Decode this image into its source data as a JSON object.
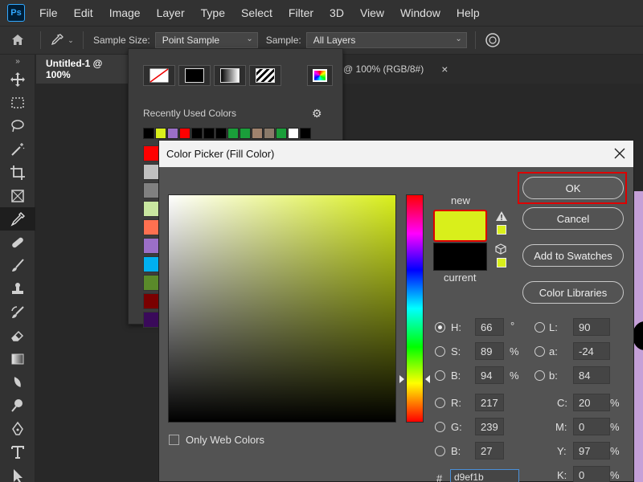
{
  "app": {
    "logo": "Ps"
  },
  "menubar": {
    "items": [
      "File",
      "Edit",
      "Image",
      "Layer",
      "Type",
      "Select",
      "Filter",
      "3D",
      "View",
      "Window",
      "Help"
    ]
  },
  "options_bar": {
    "sample_size_label": "Sample Size:",
    "sample_size_value": "Point Sample",
    "sample_label": "Sample:",
    "sample_value": "All Layers"
  },
  "document_tabs": {
    "tab1": "Untitled-1 @ 100%",
    "tab2": "@ 100% (RGB/8#)",
    "tab2_close": "×"
  },
  "swatch_popup": {
    "recent_label": "Recently Used Colors",
    "recent_colors": [
      "#000000",
      "#d9ef1b",
      "#9b6fc7",
      "#ff0000",
      "#000000",
      "#000000",
      "#000000",
      "#1a9e3a",
      "#1a9e3a",
      "#a0826d",
      "#8a7a6a",
      "#1a9e3a",
      "#ffffff",
      "#000000"
    ],
    "column_colors": [
      "#ff0000",
      "#c0c0c0",
      "#808080",
      "#c8e6a0",
      "#ff7050",
      "#9b6fc7",
      "#00b0f0",
      "#5a8a2a",
      "#7a0000",
      "#3a0a5a"
    ]
  },
  "color_picker": {
    "title": "Color Picker (Fill Color)",
    "new_label": "new",
    "current_label": "current",
    "new_color": "#d9ef1b",
    "current_color": "#000000",
    "buttons": {
      "ok": "OK",
      "cancel": "Cancel",
      "add_swatches": "Add to Swatches",
      "color_libraries": "Color Libraries"
    },
    "only_web_colors": "Only Web Colors",
    "fields": {
      "H": {
        "label": "H:",
        "value": "66",
        "unit": "°"
      },
      "S": {
        "label": "S:",
        "value": "89",
        "unit": "%"
      },
      "Bri": {
        "label": "B:",
        "value": "94",
        "unit": "%"
      },
      "R": {
        "label": "R:",
        "value": "217"
      },
      "G": {
        "label": "G:",
        "value": "239"
      },
      "Blue": {
        "label": "B:",
        "value": "27"
      },
      "L": {
        "label": "L:",
        "value": "90"
      },
      "a": {
        "label": "a:",
        "value": "-24"
      },
      "b": {
        "label": "b:",
        "value": "84"
      },
      "C": {
        "label": "C:",
        "value": "20",
        "unit": "%"
      },
      "M": {
        "label": "M:",
        "value": "0",
        "unit": "%"
      },
      "Y": {
        "label": "Y:",
        "value": "97",
        "unit": "%"
      },
      "K": {
        "label": "K:",
        "value": "0",
        "unit": "%"
      }
    },
    "hex_label": "#",
    "hex_value": "d9ef1b"
  }
}
